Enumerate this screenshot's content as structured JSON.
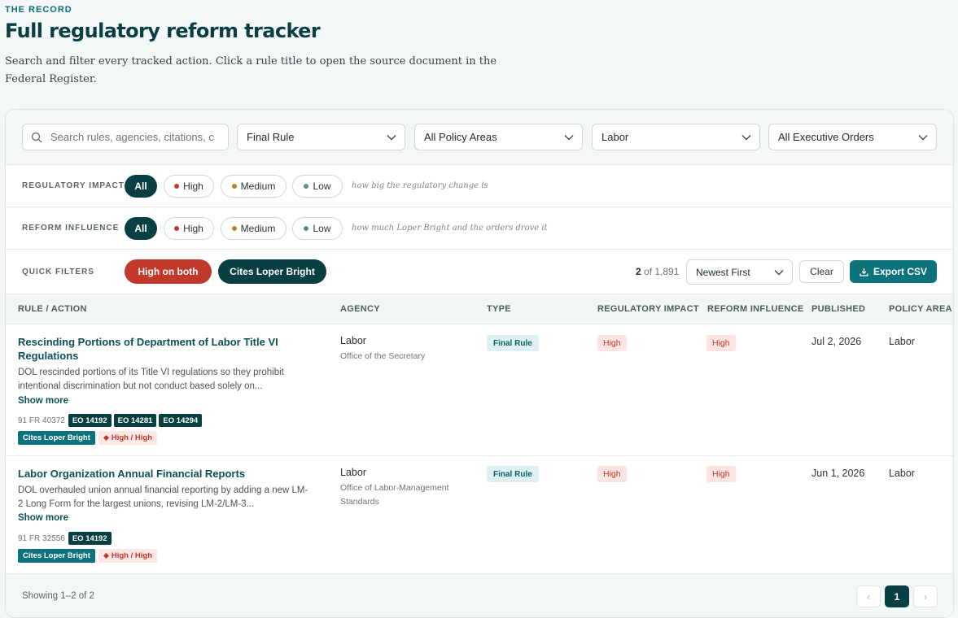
{
  "header": {
    "eyebrow": "THE RECORD",
    "title": "Full regulatory reform tracker",
    "intro": "Search and filter every tracked action. Click a rule title to open the source document in the Federal Register."
  },
  "filters": {
    "search_placeholder": "Search rules, agencies, citations, c",
    "type_select": "Final Rule",
    "policy_select": "All Policy Areas",
    "agency_select": "Labor",
    "eo_select": "All Executive Orders"
  },
  "impact": {
    "label": "REGULATORY IMPACT",
    "options": [
      "All",
      "High",
      "Medium",
      "Low"
    ],
    "hint": "how big the regulatory change is"
  },
  "influence": {
    "label": "REFORM INFLUENCE",
    "options": [
      "All",
      "High",
      "Medium",
      "Low"
    ],
    "hint": "how much Loper Bright and the orders drove it"
  },
  "quick": {
    "label": "QUICK FILTERS",
    "high_both": "High on both",
    "cites_loper": "Cites Loper Bright",
    "count_shown": "2",
    "count_total": "of 1,891",
    "sort": "Newest First",
    "clear": "Clear",
    "export": "Export CSV"
  },
  "columns": [
    "RULE / ACTION",
    "AGENCY",
    "TYPE",
    "REGULATORY IMPACT",
    "REFORM INFLUENCE",
    "PUBLISHED",
    "POLICY AREA"
  ],
  "rows": [
    {
      "title": "Rescinding Portions of Department of Labor Title VI Regulations",
      "desc": "DOL rescinded portions of its Title VI regulations so they prohibit intentional discrimination but not conduct based solely on...",
      "show_more": "Show more",
      "citation": "91 FR 40372",
      "eos": [
        "EO 14192",
        "EO 14281",
        "EO 14294"
      ],
      "tag_loper": "Cites Loper Bright",
      "tag_hh": "High / High",
      "agency": "Labor",
      "subagency": "Office of the Secretary",
      "type": "Final Rule",
      "impact": "High",
      "influence": "High",
      "published": "Jul 2, 2026",
      "policy": "Labor"
    },
    {
      "title": "Labor Organization Annual Financial Reports",
      "desc": "DOL overhauled union annual financial reporting by adding a new LM-2 Long Form for the largest unions, revising LM-2/LM-3...",
      "show_more": "Show more",
      "citation": "91 FR 32556",
      "eos": [
        "EO 14192"
      ],
      "tag_loper": "Cites Loper Bright",
      "tag_hh": "High / High",
      "agency": "Labor",
      "subagency": "Office of Labor-Management Standards",
      "type": "Final Rule",
      "impact": "High",
      "influence": "High",
      "published": "Jun 1, 2026",
      "policy": "Labor"
    }
  ],
  "footer": {
    "showing": "Showing 1–2 of 2",
    "prev": "‹",
    "page": "1",
    "next": "›"
  },
  "colors": {
    "accent": "#083f43",
    "teal": "#0c727c",
    "high": "#c0392b",
    "medium": "#b38a1a",
    "low": "#5b8a8e"
  }
}
